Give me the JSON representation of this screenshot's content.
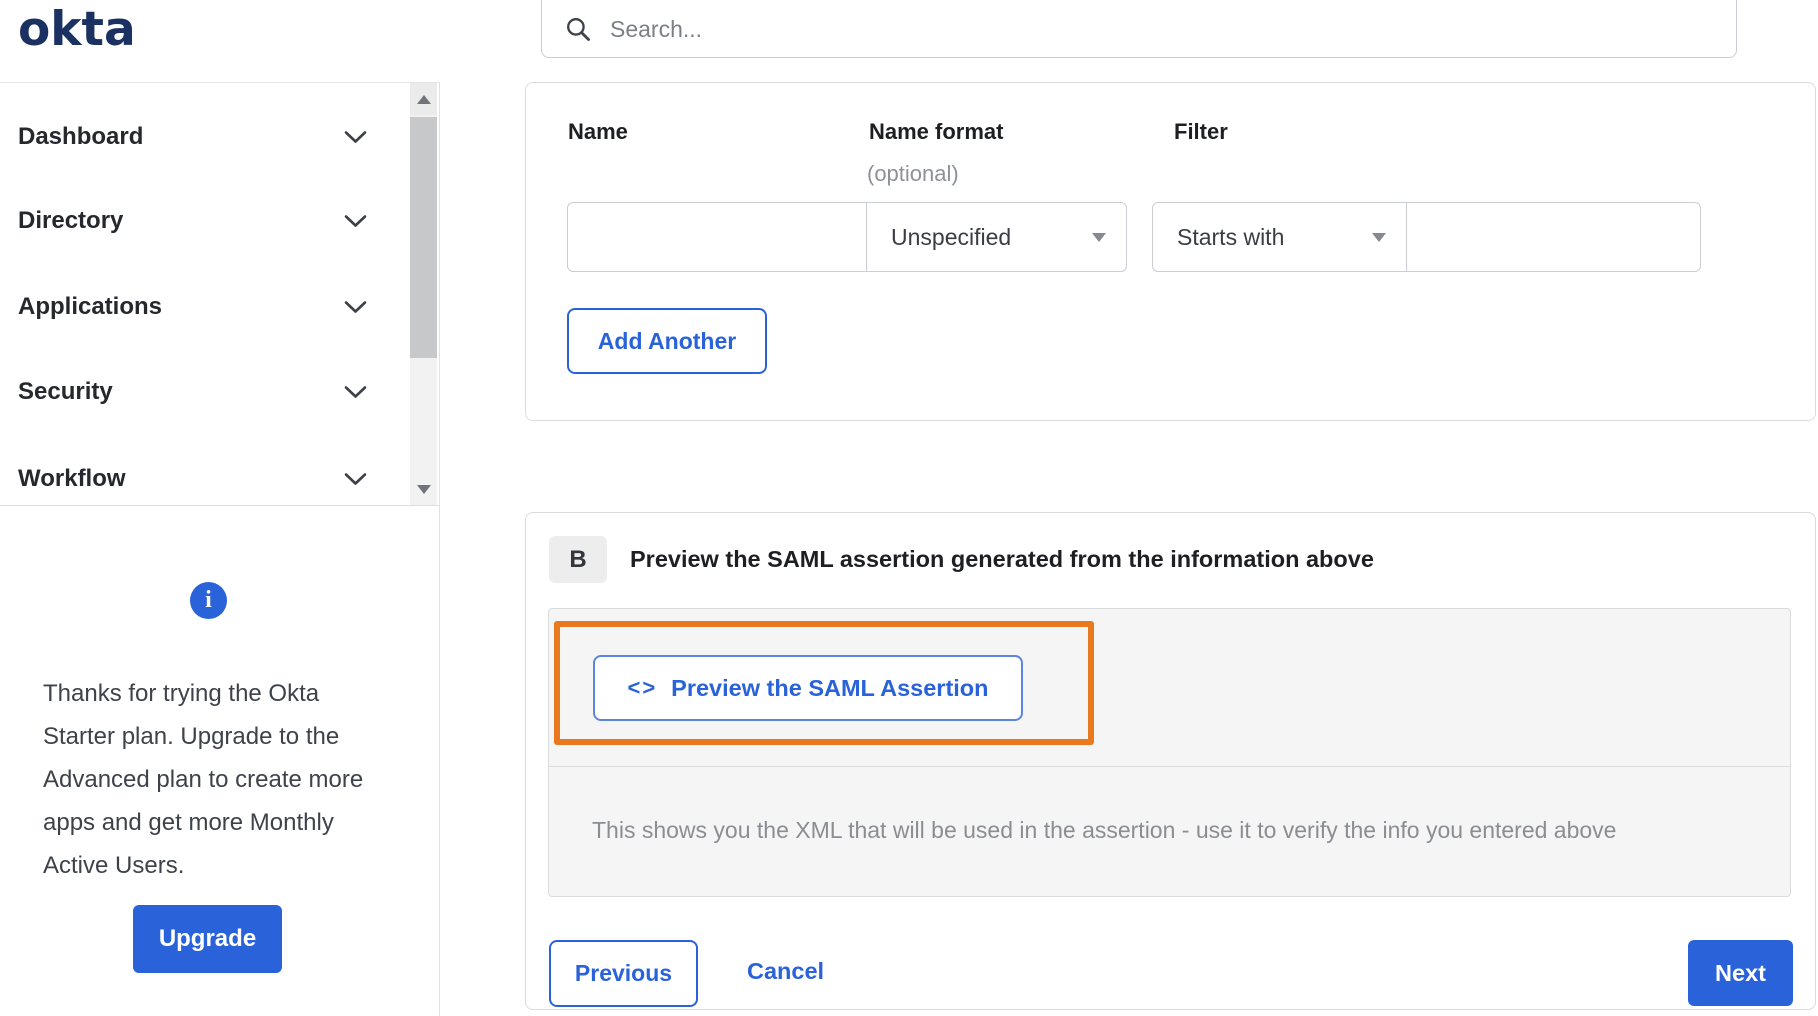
{
  "brand": {
    "logo_text": "okta",
    "navy": "#1A3162"
  },
  "header": {
    "search_placeholder": "Search..."
  },
  "sidebar": {
    "items": [
      {
        "label": "Dashboard"
      },
      {
        "label": "Directory"
      },
      {
        "label": "Applications"
      },
      {
        "label": "Security"
      },
      {
        "label": "Workflow"
      }
    ],
    "upgrade": {
      "message": "Thanks for trying the Okta Starter plan. Upgrade to the Advanced plan to create more apps and get more Monthly Active Users.",
      "button_label": "Upgrade",
      "info_glyph": "i"
    }
  },
  "form": {
    "columns": {
      "name": "Name",
      "name_format": "Name format",
      "name_format_note": "(optional)",
      "filter": "Filter"
    },
    "row": {
      "name_value": "",
      "name_format_value": "Unspecified",
      "filter_type_value": "Starts with",
      "filter_value": ""
    },
    "add_another_label": "Add Another"
  },
  "section_b": {
    "badge": "B",
    "title": "Preview the SAML assertion generated from the information above",
    "code_glyph": "<>",
    "preview_button_label": "Preview the SAML Assertion",
    "description": "This shows you the XML that will be used in the assertion - use it to verify the info you entered above",
    "highlight_color": "#E8791F"
  },
  "footer": {
    "previous_label": "Previous",
    "cancel_label": "Cancel",
    "next_label": "Next"
  },
  "colors": {
    "accent_blue": "#2A63D9",
    "navy": "#1A3162",
    "highlight_orange": "#E8791F",
    "panel_gray": "#F5F5F6"
  }
}
